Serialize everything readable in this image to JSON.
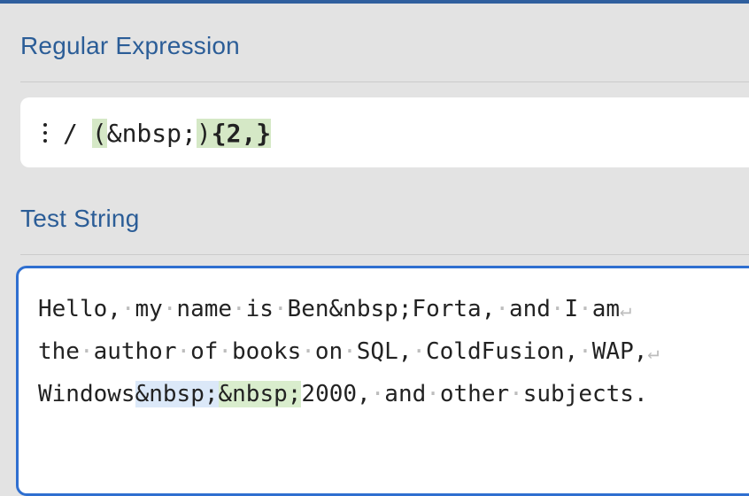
{
  "regex_section": {
    "title": "Regular Expression"
  },
  "regex": {
    "delimiter": "/",
    "group_open": "(",
    "group_body": "&nbsp;",
    "group_close": ")",
    "quantifier": "{2,}"
  },
  "test_section": {
    "title": "Test String"
  },
  "test_string": {
    "line1": [
      "Hello,",
      "my",
      "name",
      "is",
      "Ben&nbsp;Forta,",
      "and",
      "I",
      "am"
    ],
    "line2": [
      "the",
      "author",
      "of",
      "books",
      "on",
      "SQL,",
      "ColdFusion,",
      "WAP,"
    ],
    "line3_prefix": "Windows",
    "line3_match1": "&nbsp;",
    "line3_match2": "&nbsp;",
    "line3_suffix": [
      "2000,",
      "and",
      "other",
      "subjects."
    ]
  },
  "colors": {
    "accent": "#2f6fd0",
    "title": "#2b5d97",
    "match_even": "#dbe8f8",
    "match_odd": "#d9edcd"
  },
  "icons": {
    "flags_menu": "vertical-dots-icon",
    "newline": "return-arrow-icon"
  }
}
